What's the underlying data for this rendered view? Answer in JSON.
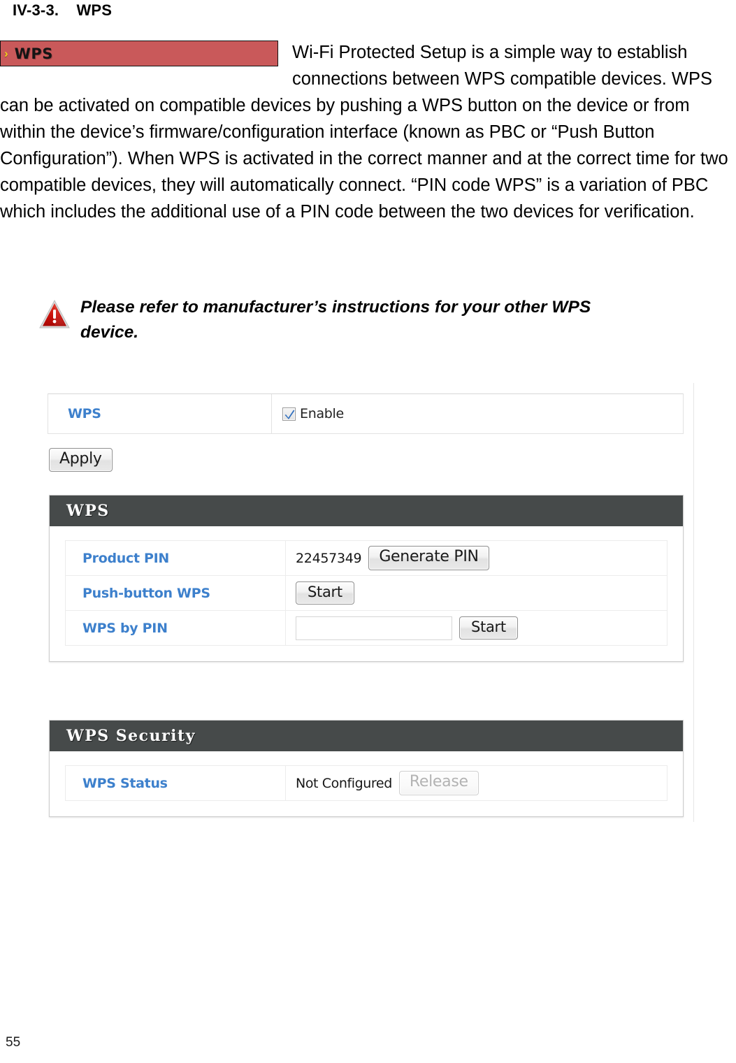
{
  "document": {
    "section_heading": "IV-3-3.    WPS",
    "page_number": "55"
  },
  "banner": {
    "chevron": "›",
    "title": "WPS",
    "bg_color": "#c9595a",
    "chevron_color": "#f2d21a"
  },
  "intro": {
    "paragraph": "Wi-Fi Protected Setup is a simple way to establish connections between WPS compatible devices. WPS can be activated on compatible devices by pushing a WPS button on the device or from within the device’s firmware/configuration interface (known as PBC or “Push Button Configuration”). When WPS is activated in the correct manner and at the correct time for two compatible devices, they will automatically connect. “PIN code WPS” is a variation of PBC which includes the additional use of a PIN code between the two devices for verification."
  },
  "note": {
    "icon": "warning-triangle-icon",
    "text": "Please refer to manufacturer’s instructions for your other WPS device."
  },
  "screenshot": {
    "enable_row": {
      "label": "WPS",
      "checkbox_checked": true,
      "checkbox_label": "Enable"
    },
    "apply_button": "Apply",
    "panels": [
      {
        "title": "WPS",
        "rows": [
          {
            "label": "Product PIN",
            "value": "22457349",
            "button": "Generate PIN",
            "button_disabled": false
          },
          {
            "label": "Push-button WPS",
            "value": "",
            "button": "Start",
            "button_disabled": false
          },
          {
            "label": "WPS by PIN",
            "input_value": "",
            "button": "Start",
            "button_disabled": false
          }
        ]
      },
      {
        "title": "WPS Security",
        "rows": [
          {
            "label": "WPS Status",
            "value": "Not Configured",
            "button": "Release",
            "button_disabled": true
          }
        ]
      }
    ],
    "colors": {
      "panel_header_bg": "#464a4a",
      "label_blue": "#3d80cc"
    }
  }
}
